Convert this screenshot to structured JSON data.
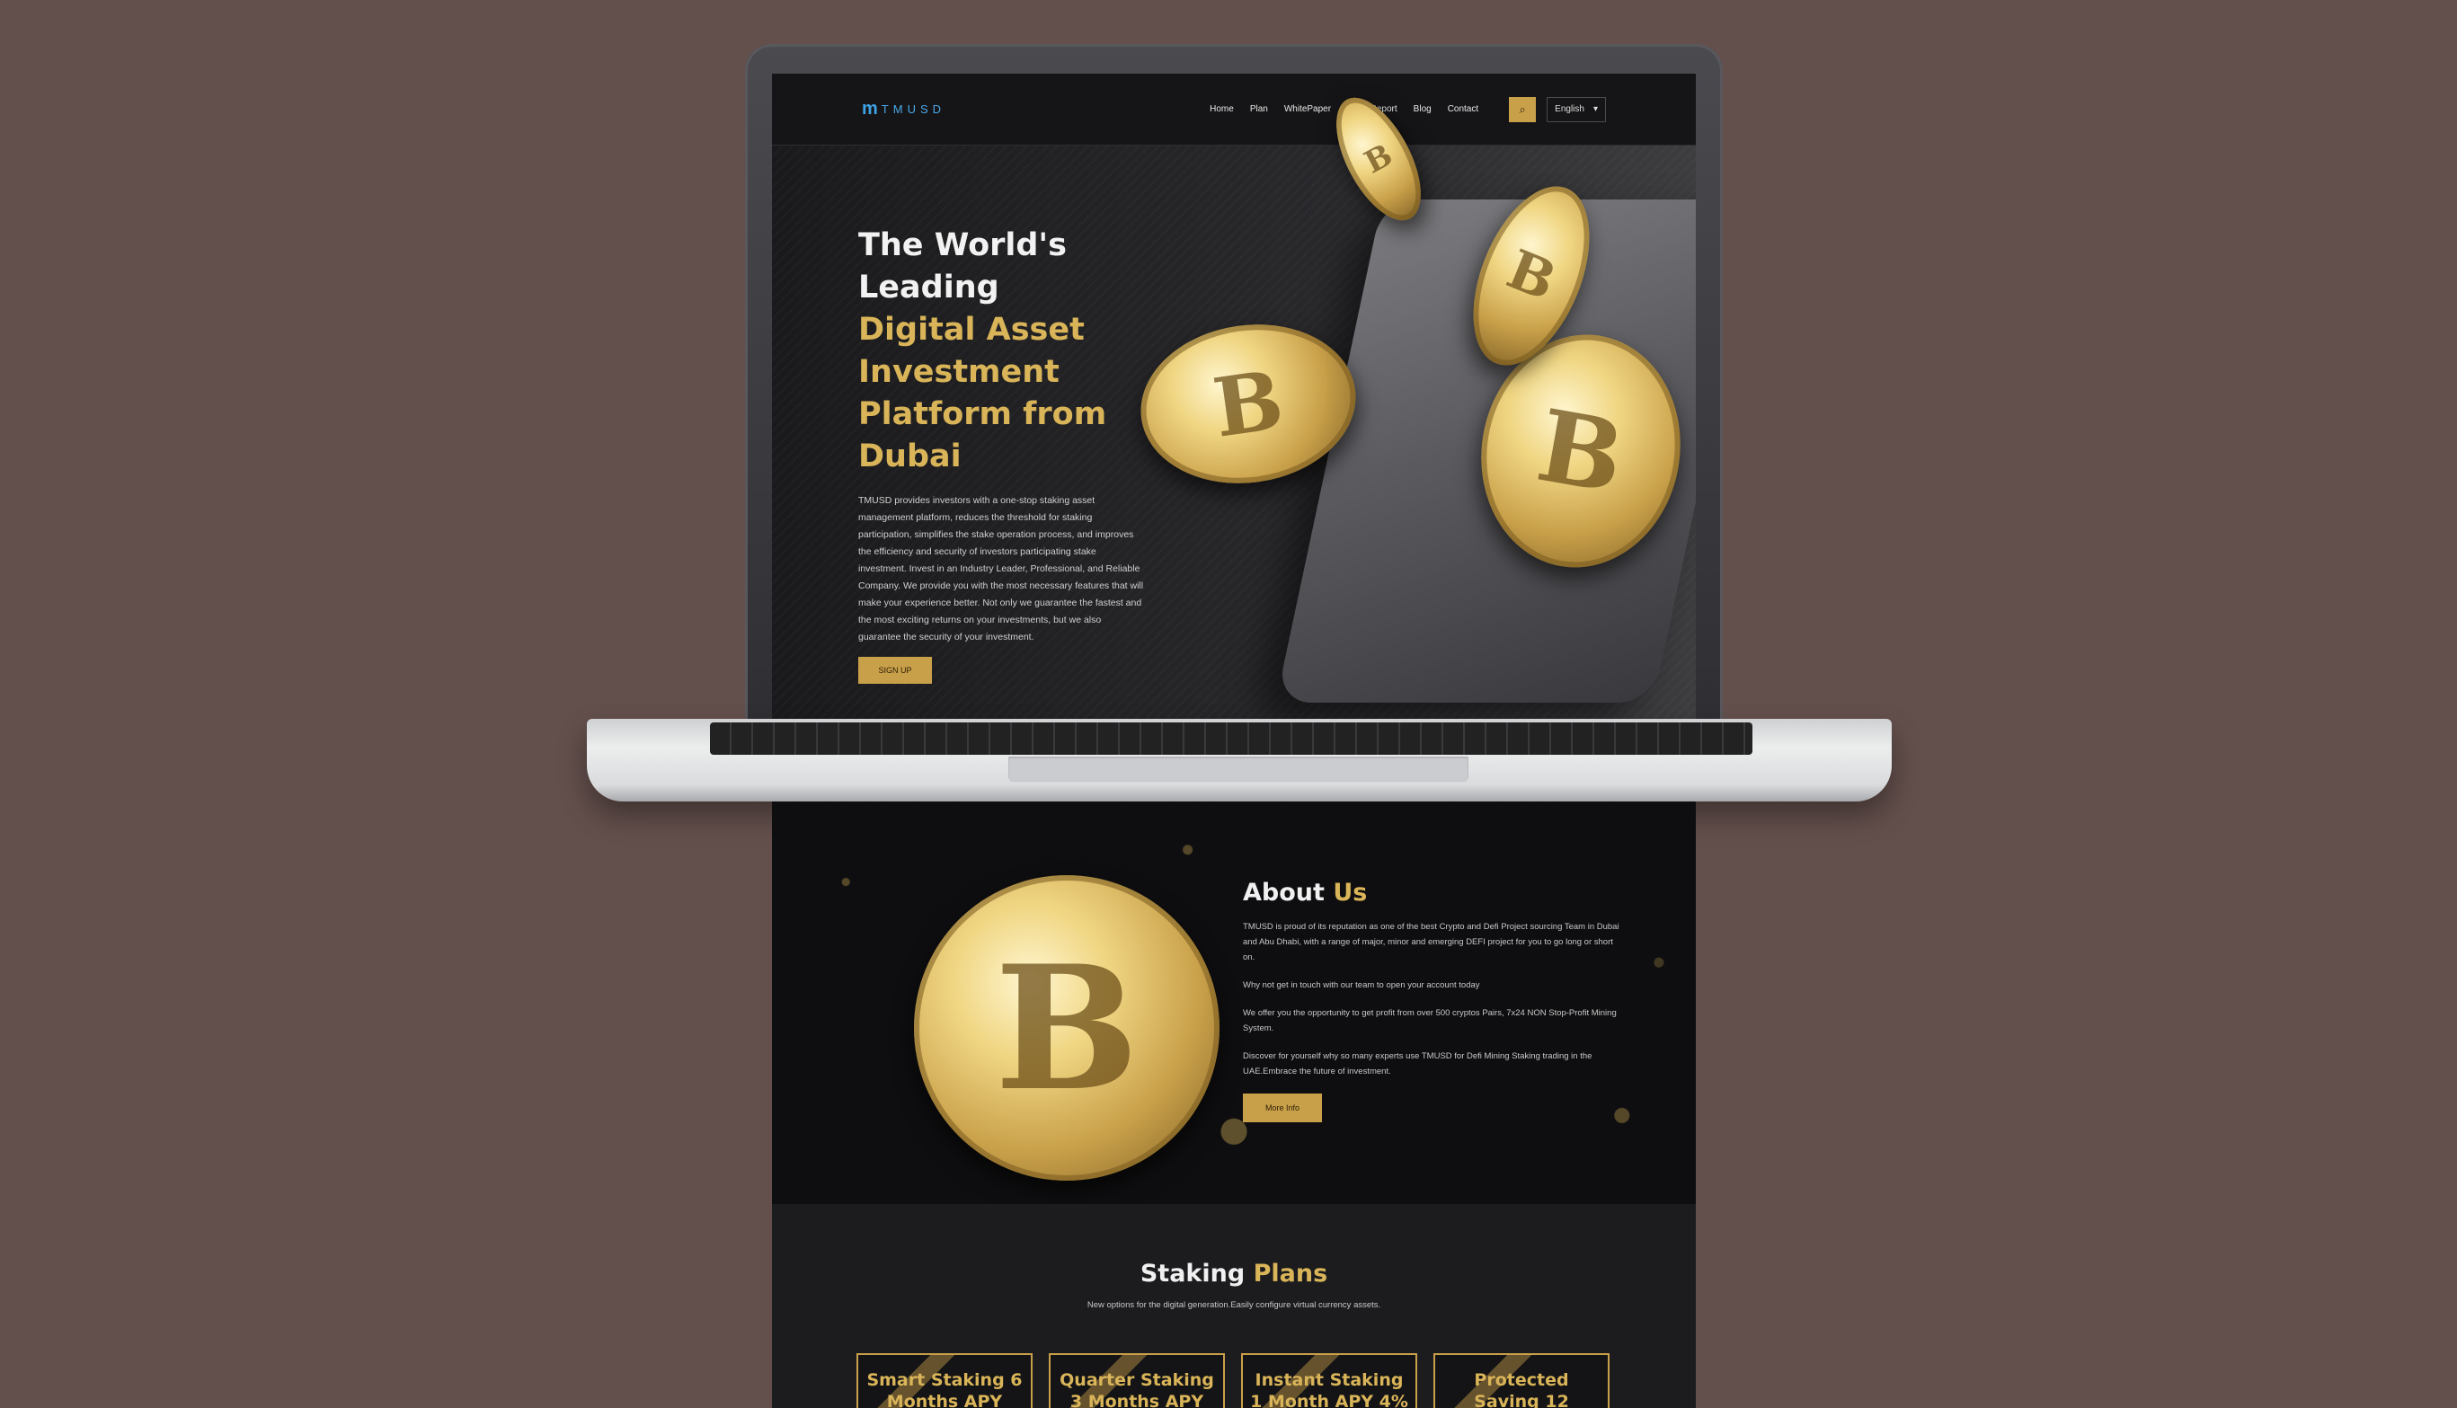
{
  "header": {
    "logo_mark": "m",
    "logo_text": "TMUSD",
    "nav": [
      "Home",
      "Plan",
      "WhitePaper",
      "Audit Report",
      "Blog",
      "Contact"
    ],
    "search_icon": "search-icon",
    "language": "English",
    "language_caret": "▾"
  },
  "hero": {
    "title_white": [
      "The World's",
      "Leading"
    ],
    "title_gold": [
      "Digital Asset",
      "Investment",
      "Platform from",
      "Dubai"
    ],
    "description": "TMUSD provides investors with a one-stop staking asset management platform, reduces the threshold for staking participation, simplifies the stake operation process, and improves the efficiency and security of investors participating stake investment. Invest in an Industry Leader, Professional, and Reliable Company. We provide you with the most necessary features that will make your experience better. Not only we guarantee the fastest and the most exciting returns on your investments, but we also guarantee the security of your investment.",
    "cta": "SIGN UP",
    "coin_symbol": "B"
  },
  "about": {
    "title": "About",
    "title_accent": "Us",
    "paragraphs": [
      "TMUSD is proud of its reputation as one of the best Crypto and Defi Project sourcing Team in Dubai and Abu Dhabi, with a range of major, minor and emerging DEFI project for you to go long or short on.",
      "Why not get in touch with our team to open your account today",
      "We offer you the opportunity to get profit from over 500 cryptos Pairs, 7x24 NON Stop-Profit Mining System.",
      "Discover for yourself why so many experts use TMUSD for Defi Mining Staking trading in the UAE.Embrace the future of investment."
    ],
    "cta": "More Info",
    "coin_symbol": "B"
  },
  "plans": {
    "title": "Staking",
    "title_accent": "Plans",
    "subtitle": "New options for the digital generation.Easily configure virtual currency assets.",
    "cards": [
      {
        "line1": "Smart Staking 6",
        "line2": "Months APY"
      },
      {
        "line1": "Quarter Staking",
        "line2": "3 Months APY"
      },
      {
        "line1": "Instant Staking",
        "line2": "1 Month APY 4%"
      },
      {
        "line1": "Protected",
        "line2": "Saving 12"
      }
    ]
  },
  "colors": {
    "background": "#634f4c",
    "gold": "#d9b458",
    "button_gold": "#c9a04a",
    "logo_blue": "#4aa8e8"
  }
}
